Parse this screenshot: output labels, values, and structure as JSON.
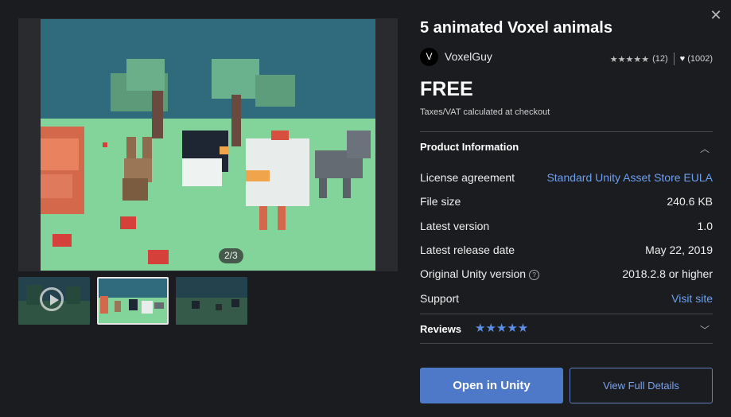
{
  "dialog": {
    "close_icon": "close-icon"
  },
  "gallery": {
    "counter": "2/3",
    "thumbnails": [
      "video-thumbnail",
      "animals-scene",
      "night-scene"
    ]
  },
  "product": {
    "title": "5 animated Voxel animals",
    "publisher_initial": "V",
    "publisher": "VoxelGuy",
    "rating_stars": "★★★★★",
    "rating_count": "(12)",
    "favorites_count": "(1002)",
    "price": "FREE",
    "tax_note": "Taxes/VAT calculated at checkout"
  },
  "product_info": {
    "heading": "Product Information",
    "rows": [
      {
        "label": "License agreement",
        "value": "Standard Unity Asset Store EULA",
        "link": true
      },
      {
        "label": "File size",
        "value": "240.6 KB"
      },
      {
        "label": "Latest version",
        "value": "1.0"
      },
      {
        "label": "Latest release date",
        "value": "May 22, 2019"
      },
      {
        "label": "Original Unity version",
        "value": "2018.2.8 or higher",
        "help": true
      },
      {
        "label": "Support",
        "value": "Visit site",
        "link": true
      }
    ]
  },
  "reviews": {
    "heading": "Reviews",
    "stars": "★★★★★"
  },
  "actions": {
    "open": "Open in Unity",
    "details": "View Full Details"
  },
  "colors": {
    "accent": "#4d79c8",
    "link": "#6e9ff0",
    "background": "#1b1c1f"
  }
}
